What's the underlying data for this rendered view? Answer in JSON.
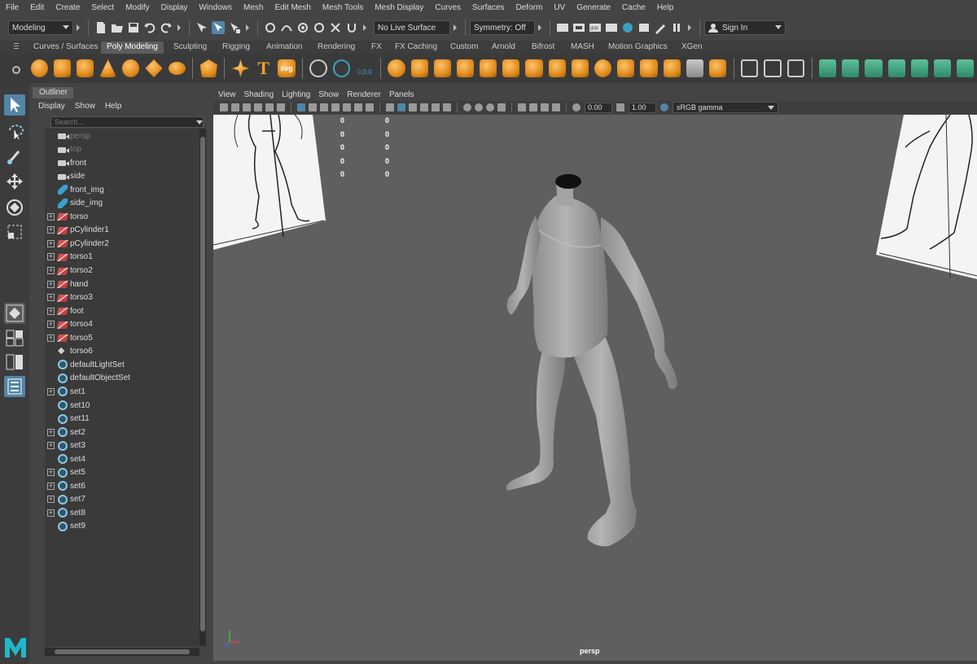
{
  "menubar": [
    "File",
    "Edit",
    "Create",
    "Select",
    "Modify",
    "Display",
    "Windows",
    "Mesh",
    "Edit Mesh",
    "Mesh Tools",
    "Mesh Display",
    "Curves",
    "Surfaces",
    "Deform",
    "UV",
    "Generate",
    "Cache",
    "Help"
  ],
  "statusline": {
    "mode": "Modeling",
    "live_surface": "No Live Surface",
    "symmetry": "Symmetry: Off",
    "sign_in": "Sign In"
  },
  "shelf_tabs": [
    "Curves / Surfaces",
    "Poly Modeling",
    "Sculpting",
    "Rigging",
    "Animation",
    "Rendering",
    "FX",
    "FX Caching",
    "Custom",
    "Arnold",
    "Bifrost",
    "MASH",
    "Motion Graphics",
    "XGen"
  ],
  "shelf_active_tab": "Poly Modeling",
  "shelf_text_icons": {
    "T": "T",
    "svg": "svg",
    "coords": "0,0,0"
  },
  "outliner": {
    "title": "Outliner",
    "menu": [
      "Display",
      "Show",
      "Help"
    ],
    "search_placeholder": "Search...",
    "items": [
      {
        "label": "persp",
        "icon": "camera-icon",
        "dim": true,
        "expander": false
      },
      {
        "label": "top",
        "icon": "camera-icon",
        "dim": true,
        "expander": false
      },
      {
        "label": "front",
        "icon": "camera-icon",
        "dim": false,
        "expander": false
      },
      {
        "label": "side",
        "icon": "camera-icon",
        "dim": false,
        "expander": false
      },
      {
        "label": "front_img",
        "icon": "image-plane-icon",
        "dim": false,
        "expander": false
      },
      {
        "label": "side_img",
        "icon": "image-plane-icon",
        "dim": false,
        "expander": false
      },
      {
        "label": "torso",
        "icon": "mesh-icon",
        "dim": false,
        "expander": true
      },
      {
        "label": "pCylinder1",
        "icon": "mesh-icon",
        "dim": false,
        "expander": true
      },
      {
        "label": "pCylinder2",
        "icon": "mesh-icon",
        "dim": false,
        "expander": true
      },
      {
        "label": "torso1",
        "icon": "mesh-icon",
        "dim": false,
        "expander": true
      },
      {
        "label": "torso2",
        "icon": "mesh-icon",
        "dim": false,
        "expander": true
      },
      {
        "label": "hand",
        "icon": "mesh-icon",
        "dim": false,
        "expander": true
      },
      {
        "label": "torso3",
        "icon": "mesh-icon",
        "dim": false,
        "expander": true
      },
      {
        "label": "foot",
        "icon": "mesh-icon",
        "dim": false,
        "expander": true
      },
      {
        "label": "torso4",
        "icon": "mesh-icon",
        "dim": false,
        "expander": true
      },
      {
        "label": "torso5",
        "icon": "mesh-icon",
        "dim": false,
        "expander": true
      },
      {
        "label": "torso6",
        "icon": "group-icon",
        "dim": false,
        "expander": false
      },
      {
        "label": "defaultLightSet",
        "icon": "set-icon",
        "dim": false,
        "expander": false
      },
      {
        "label": "defaultObjectSet",
        "icon": "set-icon",
        "dim": false,
        "expander": false
      },
      {
        "label": "set1",
        "icon": "set-icon",
        "dim": false,
        "expander": true
      },
      {
        "label": "set10",
        "icon": "set-icon",
        "dim": false,
        "expander": false
      },
      {
        "label": "set11",
        "icon": "set-icon",
        "dim": false,
        "expander": false
      },
      {
        "label": "set2",
        "icon": "set-icon",
        "dim": false,
        "expander": true
      },
      {
        "label": "set3",
        "icon": "set-icon",
        "dim": false,
        "expander": true
      },
      {
        "label": "set4",
        "icon": "set-icon",
        "dim": false,
        "expander": false
      },
      {
        "label": "set5",
        "icon": "set-icon",
        "dim": false,
        "expander": true
      },
      {
        "label": "set6",
        "icon": "set-icon",
        "dim": false,
        "expander": true
      },
      {
        "label": "set7",
        "icon": "set-icon",
        "dim": false,
        "expander": true
      },
      {
        "label": "set8",
        "icon": "set-icon",
        "dim": false,
        "expander": true
      },
      {
        "label": "set9",
        "icon": "set-icon",
        "dim": false,
        "expander": false
      }
    ]
  },
  "viewport": {
    "panel_menu": [
      "View",
      "Shading",
      "Lighting",
      "Show",
      "Renderer",
      "Panels"
    ],
    "exposure": "0.00",
    "gamma": "1.00",
    "color_space": "sRGB gamma",
    "hud_rows": [
      [
        "0",
        "0"
      ],
      [
        "0",
        "0"
      ],
      [
        "0",
        "0"
      ],
      [
        "0",
        "0"
      ],
      [
        "0",
        "0"
      ]
    ],
    "camera_label": "persp"
  },
  "colors": {
    "active_blue": "#5285a6",
    "shelf_orange": "#e08a1a",
    "shelf_green": "#3fa07c",
    "maya_logo": "#1fb8c9"
  }
}
